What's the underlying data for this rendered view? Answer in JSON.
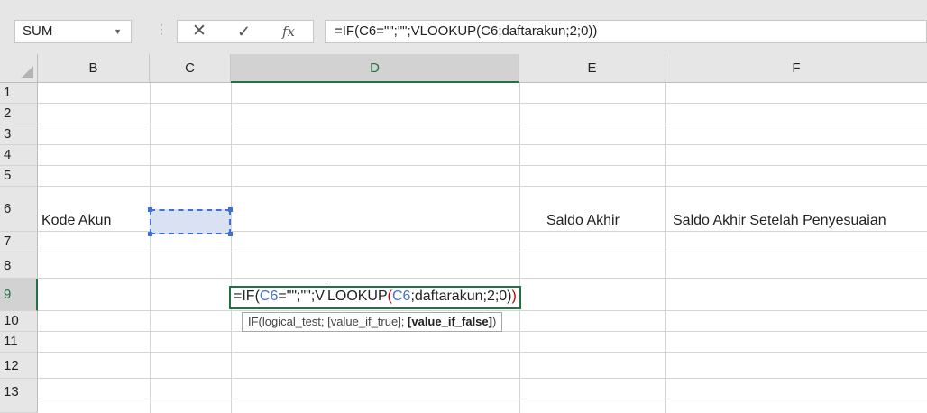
{
  "formula_bar": {
    "name_box": "SUM",
    "cancel_icon": "✕",
    "enter_icon": "✓",
    "fx_icon": "fx",
    "formula": "=IF(C6=\"\";\"\";VLOOKUP(C6;daftarakun;2;0))"
  },
  "columns": [
    "B",
    "C",
    "D",
    "E",
    "F"
  ],
  "rows": [
    "1",
    "2",
    "3",
    "4",
    "5",
    "6",
    "7",
    "8",
    "9",
    "10",
    "11",
    "12",
    "13"
  ],
  "cells": {
    "B6": "Kode Akun",
    "E6": "Saldo Akhir",
    "F6": "Saldo Akhir Setelah Penyesuaian"
  },
  "edit_cell": {
    "prefix": "=IF(",
    "ref1": "C6",
    "mid1": "=\"\";\"\";V",
    "mid2": "LOOKUP",
    "open_paren": "(",
    "ref2": "C6",
    "rest": ";daftarakun;2;0)",
    "close_paren": ")"
  },
  "tooltip": {
    "text": "IF(logical_test; [value_if_true]; ",
    "bold": "[value_if_false]",
    "end": ")"
  },
  "colors": {
    "accent": "#217346",
    "ref_blue": "#4472c4",
    "paren_red": "#c00000"
  }
}
